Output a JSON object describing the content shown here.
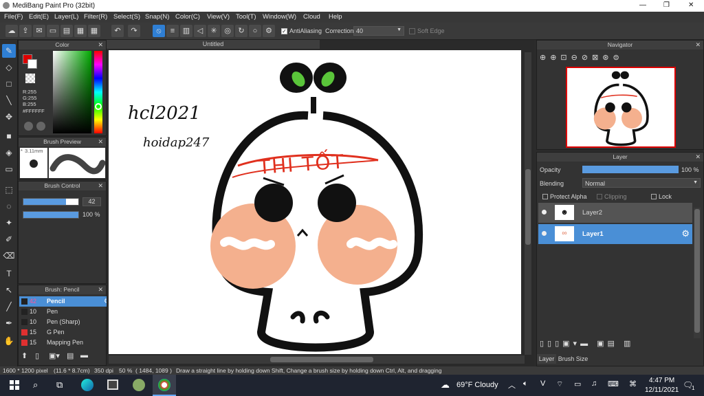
{
  "app": {
    "title": "MediBang Paint Pro (32bit)"
  },
  "window_controls": {
    "minimize": "—",
    "maximize": "❐",
    "close": "✕"
  },
  "menu": [
    "File(F)",
    "Edit(E)",
    "Layer(L)",
    "Filter(R)",
    "Select(S)",
    "Snap(N)",
    "Color(C)",
    "View(V)",
    "Tool(T)",
    "Window(W)",
    "Cloud",
    "Help"
  ],
  "toolbar": {
    "antialiasing_label": "AntiAliasing",
    "correction_label": "Correction",
    "correction_value": "40",
    "soft_edge_label": "Soft Edge"
  },
  "color_panel": {
    "title": "Color",
    "r": "R:255",
    "g": "G:255",
    "b": "B:255",
    "hex": "#FFFFFF"
  },
  "brush_preview": {
    "title": "Brush Preview",
    "size": "3.11mm"
  },
  "brush_control": {
    "title": "Brush Control",
    "size_value": "42",
    "opacity_value": "100 %",
    "size_fraction": 0.78,
    "opacity_fraction": 1.0
  },
  "brush_list": {
    "title": "Brush: Pencil",
    "items": [
      {
        "size": "42",
        "name": "Pencil",
        "color": "#222222",
        "selected": true
      },
      {
        "size": "10",
        "name": "Pen",
        "color": "#222222",
        "selected": false
      },
      {
        "size": "10",
        "name": "Pen (Sharp)",
        "color": "#222222",
        "selected": false
      },
      {
        "size": "15",
        "name": "G Pen",
        "color": "#e03030",
        "selected": false
      },
      {
        "size": "15",
        "name": "Mapping Pen",
        "color": "#e03030",
        "selected": false
      }
    ]
  },
  "document": {
    "tab": "Untitled"
  },
  "artwork": {
    "handwriting1": "hcl2021",
    "handwriting2": "hoidap247",
    "band_text": "THI TỐT"
  },
  "navigator": {
    "title": "Navigator"
  },
  "layer_panel": {
    "title": "Layer",
    "opacity_label": "Opacity",
    "opacity_value": "100 %",
    "opacity_fraction": 1.0,
    "blending_label": "Blending",
    "blending_value": "Normal",
    "protect_alpha": "Protect Alpha",
    "clipping": "Clipping",
    "lock": "Lock",
    "layers": [
      {
        "name": "Layer2",
        "selected": false
      },
      {
        "name": "Layer1",
        "selected": true
      }
    ]
  },
  "bottom_tabs": {
    "layer": "Layer",
    "brush_size": "Brush Size"
  },
  "status": {
    "dimensions": "1600 * 1200 pixel",
    "physical": "(11.6 * 8.7cm)",
    "dpi": "350 dpi",
    "zoom": "50 %",
    "coords": "( 1484, 1089 )",
    "hint": "Draw a straight line by holding down Shift, Change a brush size by holding down Ctrl, Alt, and dragging"
  },
  "taskbar": {
    "weather": "69°F  Cloudy",
    "time": "4:47 PM",
    "date": "12/11/2021",
    "notifications": "1"
  },
  "colors": {
    "accent": "#2f7fd4",
    "cheek": "#f4b08e",
    "band": "#e0301e",
    "leaf": "#5ac53a"
  }
}
